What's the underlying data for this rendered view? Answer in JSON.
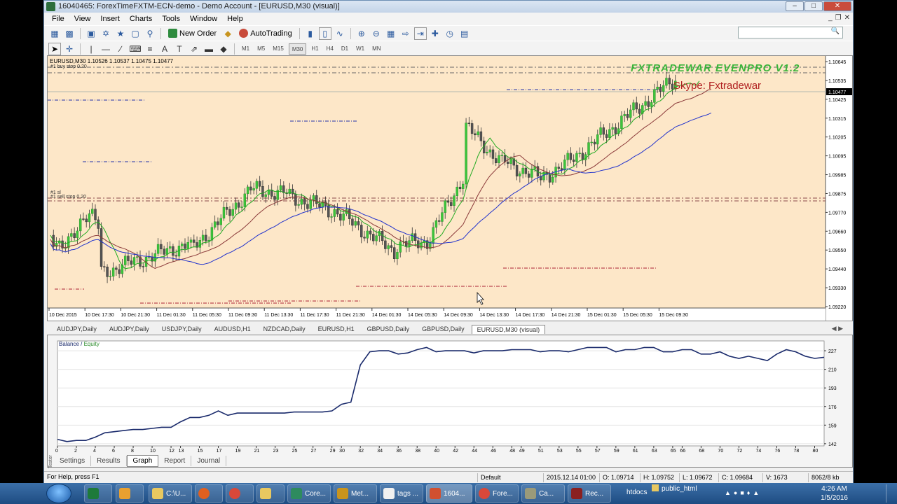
{
  "window": {
    "title": "16040465: ForexTimeFXTM-ECN-demo - Demo Account - [EURUSD,M30 (visual)]"
  },
  "menu": [
    "File",
    "View",
    "Insert",
    "Charts",
    "Tools",
    "Window",
    "Help"
  ],
  "toolbar": {
    "new_order": "New Order",
    "autotrading": "AutoTrading"
  },
  "timeframes": [
    "M1",
    "M5",
    "M15",
    "M30",
    "H1",
    "H4",
    "D1",
    "W1",
    "MN"
  ],
  "active_timeframe": "M30",
  "chart": {
    "info": "EURUSD,M30  1.10526 1.10537 1.10475 1.10477",
    "sub1": "#1 buy stop 0.20",
    "sub2": "#1 sell stop 0.20",
    "sub2b": "#1 sl",
    "indicator_name": "FXTRADEWAR EVENPRO V1.2",
    "skype_label": "Skype:",
    "skype_name": "Fxtradewar",
    "price_labels": [
      "1.10645",
      "1.10535",
      "1.10425",
      "1.10315",
      "1.10205",
      "1.10095",
      "1.09985",
      "1.09875",
      "1.09770",
      "1.09660",
      "1.09550",
      "1.09440",
      "1.09330",
      "1.09220"
    ],
    "current_price": "1.10477",
    "time_labels": [
      "10 Dec 2015",
      "10 Dec 17:30",
      "10 Dec 21:30",
      "11 Dec 01:30",
      "11 Dec 05:30",
      "11 Dec 09:30",
      "11 Dec 13:30",
      "11 Dec 17:30",
      "11 Dec 21:30",
      "14 Dec 01:30",
      "14 Dec 05:30",
      "14 Dec 09:30",
      "14 Dec 13:30",
      "14 Dec 17:30",
      "14 Dec 21:30",
      "15 Dec 01:30",
      "15 Dec 05:30",
      "15 Dec 09:30"
    ],
    "colors": {
      "bg": "#fde7c8",
      "bull": "#3cc43c",
      "bear": "#555555",
      "ma_fast": "#22aa22",
      "ma_mid": "#8b3a3a",
      "ma_slow": "#2233cc"
    }
  },
  "chart_tabs": [
    "AUDJPY,Daily",
    "AUDJPY,Daily",
    "USDJPY,Daily",
    "AUDUSD,H1",
    "NZDCAD,Daily",
    "EURUSD,H1",
    "GBPUSD,Daily",
    "GBPUSD,Daily",
    "EURUSD,M30 (visual)"
  ],
  "active_chart_tab": "EURUSD,M30 (visual)",
  "tester": {
    "title_balance": "Balance",
    "title_sep": " / ",
    "title_equity": "Equity",
    "side_label": "Tester",
    "tabs": [
      "Settings",
      "Results",
      "Graph",
      "Report",
      "Journal"
    ],
    "active_tab": "Graph"
  },
  "chart_data": {
    "type": "line",
    "title": "Balance / Equity",
    "xlabel": "",
    "ylabel": "",
    "x_ticks": [
      0,
      2,
      4,
      6,
      8,
      10,
      12,
      13,
      15,
      17,
      19,
      21,
      23,
      25,
      27,
      29,
      30,
      32,
      34,
      36,
      38,
      40,
      42,
      44,
      46,
      48,
      49,
      51,
      53,
      55,
      57,
      59,
      61,
      63,
      65,
      66,
      68,
      70,
      72,
      74,
      76,
      78,
      80
    ],
    "y_ticks": [
      142,
      159,
      176,
      193,
      210,
      227
    ],
    "xlim": [
      0,
      81
    ],
    "ylim": [
      140,
      236
    ],
    "series": [
      {
        "name": "Balance",
        "x": [
          0,
          1,
          2,
          3,
          4,
          5,
          6,
          7,
          8,
          9,
          10,
          11,
          12,
          13,
          14,
          15,
          16,
          17,
          18,
          19,
          20,
          21,
          22,
          23,
          24,
          25,
          26,
          27,
          28,
          29,
          30,
          31,
          32,
          33,
          34,
          35,
          36,
          37,
          38,
          39,
          40,
          41,
          42,
          43,
          44,
          45,
          46,
          47,
          48,
          49,
          50,
          51,
          52,
          53,
          54,
          55,
          56,
          57,
          58,
          59,
          60,
          61,
          62,
          63,
          64,
          65,
          66,
          67,
          68,
          69,
          70,
          71,
          72,
          73,
          74,
          75,
          76,
          77,
          78,
          79,
          80,
          81
        ],
        "y": [
          146,
          144,
          145,
          145,
          148,
          152,
          153,
          154,
          155,
          155,
          156,
          157,
          157,
          162,
          166,
          166,
          168,
          172,
          168,
          170,
          170,
          170,
          170,
          170,
          170,
          171,
          171,
          171,
          171,
          172,
          178,
          180,
          214,
          226,
          227,
          227,
          224,
          225,
          228,
          230,
          226,
          227,
          227,
          227,
          225,
          227,
          227,
          227,
          228,
          228,
          228,
          226,
          227,
          227,
          226,
          228,
          230,
          230,
          230,
          226,
          228,
          228,
          230,
          230,
          226,
          226,
          228,
          228,
          224,
          224,
          226,
          222,
          220,
          222,
          220,
          218,
          224,
          228,
          226,
          222,
          220,
          221
        ]
      }
    ]
  },
  "statusbar": {
    "help": "For Help, press F1",
    "profile": "Default",
    "datetime": "2015.12.14 01:00",
    "open": "O: 1.09714",
    "high": "H: 1.09752",
    "low": "L: 1.09672",
    "close": "C: 1.09684",
    "volume": "V: 1673",
    "traffic": "8062/8 kb"
  },
  "taskbar": {
    "items": [
      "C:\\U...",
      "Core...",
      "Met...",
      "tags ...",
      "1604...",
      "Fore...",
      "Ca...",
      "Rec..."
    ],
    "tray": [
      "htdocs",
      "public_html"
    ],
    "time": "4:26 AM",
    "date": "1/5/2016"
  }
}
